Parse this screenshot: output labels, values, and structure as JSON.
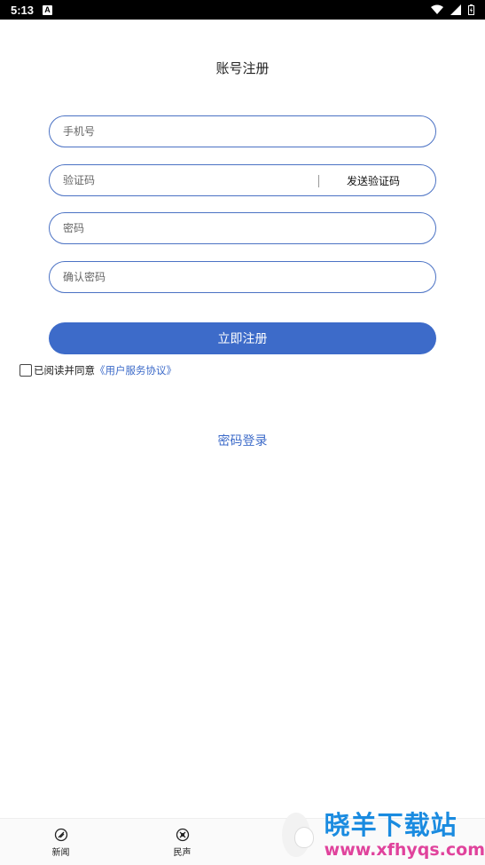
{
  "status_bar": {
    "time": "5:13",
    "indicator": "A"
  },
  "page": {
    "title": "账号注册"
  },
  "form": {
    "phone_placeholder": "手机号",
    "code_placeholder": "验证码",
    "send_code_label": "发送验证码",
    "password_placeholder": "密码",
    "confirm_placeholder": "确认密码",
    "register_label": "立即注册"
  },
  "agreement": {
    "text": "已阅读并同意",
    "link": "《用户服务协议》"
  },
  "password_login_label": "密码登录",
  "tabs": [
    {
      "label": "新闻",
      "icon": "news-icon"
    },
    {
      "label": "民声",
      "icon": "voice-icon"
    }
  ],
  "watermark": {
    "text": "晓羊下载站",
    "url": "www.xfhyqs.com"
  },
  "colors": {
    "accent": "#3d6bc9",
    "border": "#4b72c4",
    "watermark_blue": "#1a8be0",
    "watermark_pink": "#e0439c"
  }
}
